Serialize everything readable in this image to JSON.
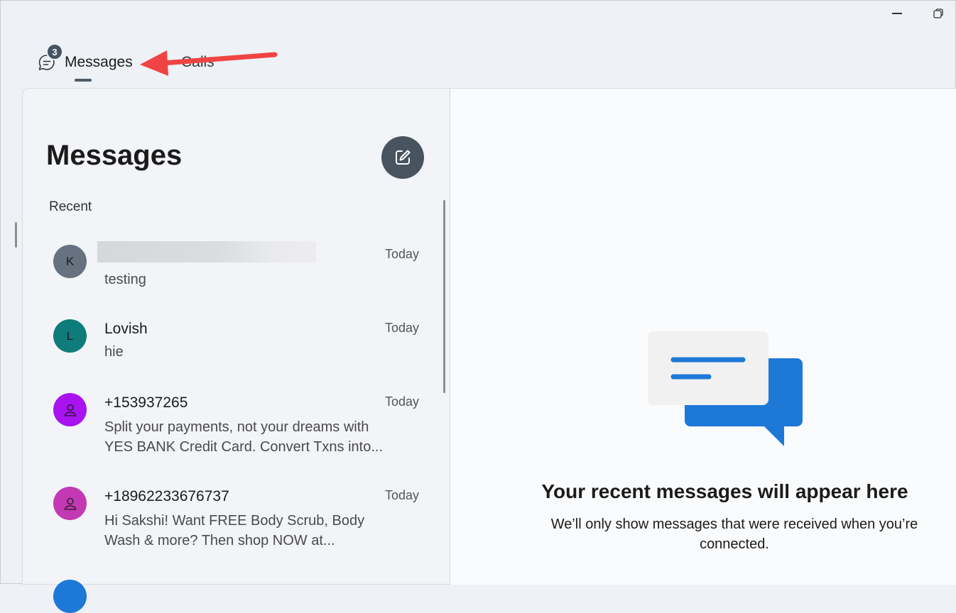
{
  "window": {
    "minimize_icon": "minimize-icon",
    "restore_icon": "restore-icon"
  },
  "tabs": [
    {
      "label": "Messages",
      "badge": "3",
      "icon": "chat-bubble-icon",
      "active": true
    },
    {
      "label": "Calls",
      "active": false
    }
  ],
  "annotation": {
    "color": "#ef4444"
  },
  "messages_pane": {
    "title": "Messages",
    "compose_icon": "compose-icon",
    "section_label": "Recent",
    "conversations": [
      {
        "initial": "K",
        "name": "",
        "preview": "testing",
        "time": "Today",
        "avatar_color": "#66727f"
      },
      {
        "initial": "L",
        "name": "Lovish",
        "preview": "hie",
        "time": "Today",
        "avatar_color": "#0e7c7b"
      },
      {
        "initial": "",
        "name": "+153937265",
        "preview": "Split your payments, not your dreams with YES BANK Credit Card. Convert Txns into...",
        "time": "Today",
        "avatar_color": "#a813f0",
        "icon": "person-icon"
      },
      {
        "initial": "",
        "name": "+18962233676737",
        "preview": "Hi Sakshi! Want FREE Body Scrub, Body Wash & more? Then shop NOW at...",
        "time": "Today",
        "avatar_color": "#c239b3",
        "icon": "person-icon"
      }
    ]
  },
  "detail_pane": {
    "empty_title": "Your recent messages will appear here",
    "empty_subtitle": "We’ll only show messages that were received when you’re connected."
  },
  "colors": {
    "accent_blue": "#1e78d7",
    "compose_bg": "#47535f",
    "badge_bg": "#465463"
  }
}
